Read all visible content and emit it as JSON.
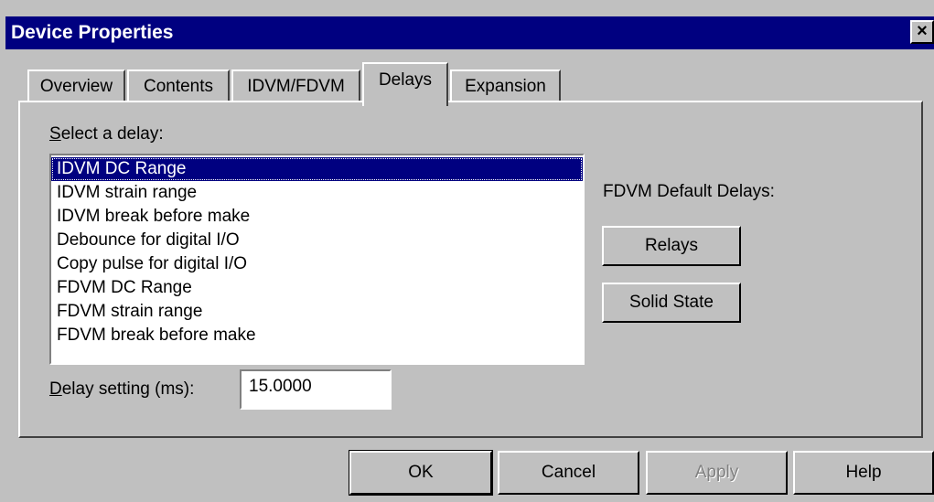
{
  "window": {
    "title": "Device Properties",
    "close_glyph": "×"
  },
  "tabs": [
    {
      "label": "Overview",
      "active": false
    },
    {
      "label": "Contents",
      "active": false
    },
    {
      "label": "IDVM/FDVM",
      "active": false
    },
    {
      "label": "Delays",
      "active": true
    },
    {
      "label": "Expansion",
      "active": false
    }
  ],
  "delays": {
    "select_label_mnemonic": "S",
    "select_label_rest": "elect a delay:",
    "items": [
      "IDVM DC Range",
      "IDVM strain range",
      "IDVM break before make",
      "Debounce for digital I/O",
      "Copy pulse for digital I/O",
      "FDVM DC Range",
      "FDVM strain range",
      "FDVM break before make"
    ],
    "selected_index": 0,
    "setting_label_mnemonic": "D",
    "setting_label_rest": "elay setting (ms):",
    "setting_value": "15.0000"
  },
  "fdvm_defaults": {
    "label": "FDVM Default Delays:",
    "relays_button": "Relays",
    "solid_state_button": "Solid State"
  },
  "footer": {
    "ok": "OK",
    "cancel": "Cancel",
    "apply": "Apply",
    "help": "Help"
  },
  "colors": {
    "titlebar": "#000080",
    "face": "#c0c0c0",
    "selection": "#000080"
  }
}
